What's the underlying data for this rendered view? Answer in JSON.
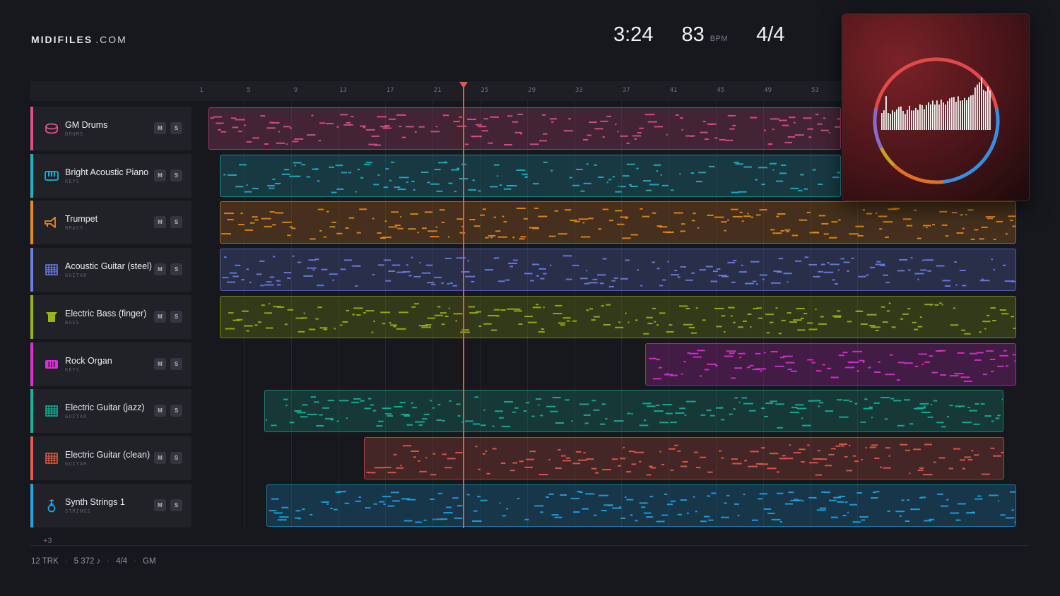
{
  "brand": {
    "name_bold": "MIDIFILES",
    "name_light": ".COM"
  },
  "stats": {
    "duration": "3:24",
    "tempo": "83",
    "tempo_unit": "BPM",
    "time_signature": "4/4"
  },
  "ruler_ticks": [
    "1",
    "5",
    "9",
    "13",
    "17",
    "21",
    "25",
    "29",
    "33",
    "37",
    "41",
    "45",
    "49",
    "53"
  ],
  "tracks": [
    {
      "name": "GM Drums",
      "category": "DRUMS",
      "color": "#e0508a",
      "icon": "drum-icon",
      "mute_label": "M",
      "solo_label": "S"
    },
    {
      "name": "Bright Acoustic Piano",
      "category": "KEYS",
      "color": "#1fb3c9",
      "icon": "piano-keys-icon",
      "mute_label": "M",
      "solo_label": "S"
    },
    {
      "name": "Trumpet",
      "category": "BRASS",
      "color": "#e98a1c",
      "icon": "trumpet-icon",
      "mute_label": "M",
      "solo_label": "S"
    },
    {
      "name": "Acoustic Guitar (steel)",
      "category": "GUITAR",
      "color": "#6c7ee8",
      "icon": "guitar-fretboard-icon",
      "mute_label": "M",
      "solo_label": "S"
    },
    {
      "name": "Electric Bass (finger)",
      "category": "BASS",
      "color": "#98b514",
      "icon": "bass-icon",
      "mute_label": "M",
      "solo_label": "S"
    },
    {
      "name": "Rock Organ",
      "category": "KEYS",
      "color": "#e02ed6",
      "icon": "organ-keys-icon",
      "mute_label": "M",
      "solo_label": "S"
    },
    {
      "name": "Electric Guitar (jazz)",
      "category": "GUITAR",
      "color": "#17b39c",
      "icon": "guitar-fretboard-icon",
      "mute_label": "M",
      "solo_label": "S"
    },
    {
      "name": "Electric Guitar (clean)",
      "category": "GUITAR",
      "color": "#e85a4a",
      "icon": "guitar-fretboard-icon",
      "mute_label": "M",
      "solo_label": "S"
    },
    {
      "name": "Synth Strings 1",
      "category": "STRINGS",
      "color": "#1ea4ea",
      "icon": "strings-icon",
      "mute_label": "M",
      "solo_label": "S"
    }
  ],
  "more_tracks": "+3",
  "footer": {
    "tracks": "12 TRK",
    "notes": "5 372 ♪",
    "time_signature": "4/4",
    "standard": "GM"
  },
  "album_art": {
    "ring_colors": [
      "#e24a4a",
      "#3a8ee0",
      "#e07028",
      "#c9a020",
      "#8a6ad0"
    ]
  },
  "playback": {
    "playhead_bar": 25
  }
}
